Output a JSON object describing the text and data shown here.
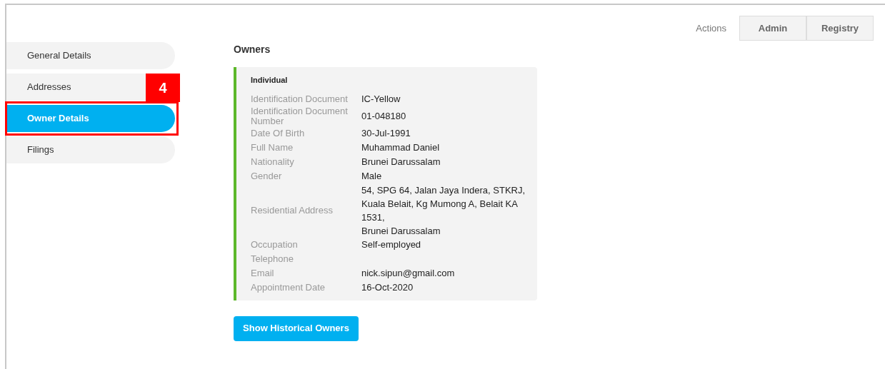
{
  "header": {
    "actions_label": "Actions",
    "tabs": [
      {
        "label": "Admin",
        "selected": false
      },
      {
        "label": "Registry",
        "selected": false
      }
    ]
  },
  "sidebar": {
    "items": [
      {
        "label": "General Details",
        "selected": false
      },
      {
        "label": "Addresses",
        "selected": false
      },
      {
        "label": "Owner Details",
        "selected": true
      },
      {
        "label": "Filings",
        "selected": false
      }
    ]
  },
  "callout": {
    "label": "4"
  },
  "section_title": "Owners",
  "owner_card": {
    "type": "Individual",
    "fields": [
      {
        "label": "Identification Document",
        "value": [
          "IC-Yellow"
        ]
      },
      {
        "label": "Identification Document Number",
        "value": [
          "01-048180"
        ]
      },
      {
        "label": "Date Of Birth",
        "value": [
          "30-Jul-1991"
        ]
      },
      {
        "label": "Full Name",
        "value": [
          "Muhammad Daniel"
        ]
      },
      {
        "label": "Nationality",
        "value": [
          "Brunei Darussalam"
        ]
      },
      {
        "label": "Gender",
        "value": [
          "Male"
        ]
      },
      {
        "label": "Residential Address",
        "value": [
          "54, SPG 64, Jalan Jaya Indera, STKRJ, Kuala Belait, Kg Mumong A, Belait KA 1531,",
          "Brunei Darussalam"
        ]
      },
      {
        "label": "Occupation",
        "value": [
          "Self-employed"
        ]
      },
      {
        "label": "Telephone"
      },
      {
        "label": "Email",
        "value": [
          "nick.sipun@gmail.com"
        ]
      },
      {
        "label": "Appointment Date",
        "value": [
          "16-Oct-2020"
        ]
      }
    ]
  },
  "button": "Show Historical Owners"
}
